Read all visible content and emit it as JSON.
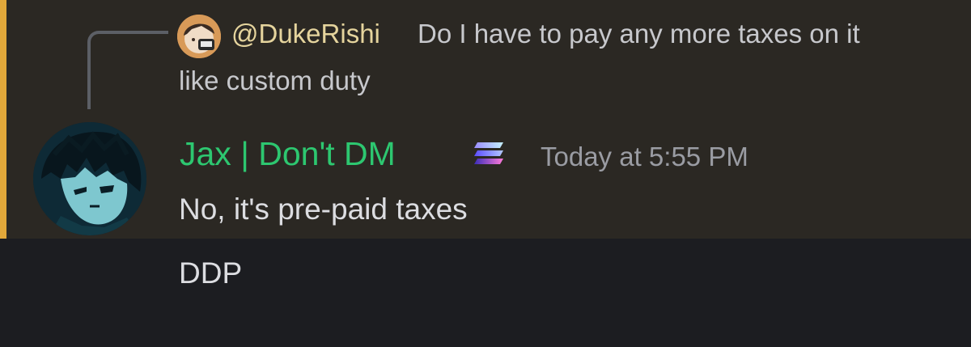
{
  "reply": {
    "author": "@DukeRishi",
    "text": "Do I have to pay any more taxes on it",
    "text_continued": "like custom duty",
    "avatar_icon": "anime-avatar-icon"
  },
  "message": {
    "author": "Jax | Don't DM",
    "timestamp": "Today at 5:55 PM",
    "lines": [
      "No, it's pre-paid taxes",
      "DDP"
    ],
    "avatar_icon": "anime-avatar-icon",
    "badge_icon": "stacked-layers-badge-icon"
  },
  "colors": {
    "background": "#1c1d21",
    "highlight_background": "#2b2823",
    "mention_bar": "#e2a83a",
    "reply_author": "#e5d49d",
    "author": "#2dc770",
    "timestamp": "#9a9ca3",
    "message_text": "#dcdde1"
  }
}
